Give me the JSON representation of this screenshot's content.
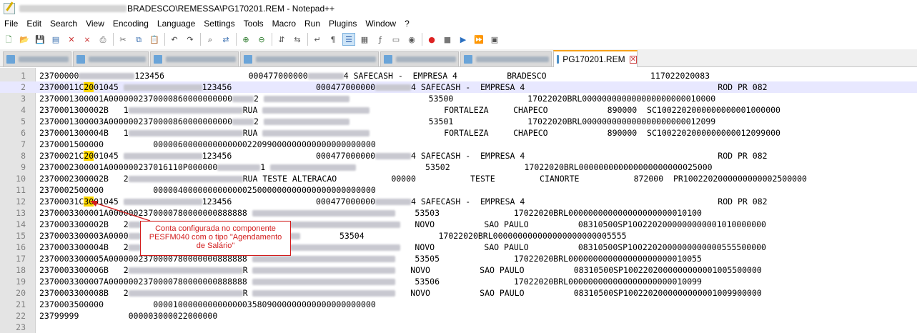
{
  "window": {
    "title": "BRADESCO\\REMESSA\\PG170201.REM - Notepad++"
  },
  "menu": [
    "File",
    "Edit",
    "Search",
    "View",
    "Encoding",
    "Language",
    "Settings",
    "Tools",
    "Macro",
    "Run",
    "Plugins",
    "Window",
    "?"
  ],
  "toolbar": {
    "icons": [
      "new-file-icon",
      "open-file-icon",
      "save-icon",
      "save-all-icon",
      "close-icon",
      "close-all-icon",
      "print-icon",
      "cut-icon",
      "copy-icon",
      "paste-icon",
      "undo-icon",
      "redo-icon",
      "find-icon",
      "replace-icon",
      "zoom-in-icon",
      "zoom-out-icon",
      "sync-vertical-icon",
      "sync-horizontal-icon",
      "word-wrap-icon",
      "show-all-chars-icon",
      "indent-guide-icon",
      "doc-map-icon",
      "function-list-icon",
      "folder-workspace-icon",
      "monitor-icon",
      "record-macro-icon",
      "stop-macro-icon",
      "play-macro-icon",
      "run-macro-multiple-icon",
      "save-macro-icon"
    ]
  },
  "tabs": {
    "active_label": "PG170201.REM"
  },
  "editor": {
    "lines": [
      {
        "n": "1",
        "segs": [
          {
            "t": "23700000"
          },
          {
            "m": 78
          },
          {
            "t": "123456                 000477000000"
          },
          {
            "m": 50
          },
          {
            "t": "4 SAFECASH -  EMPRESA 4          BRADESCO                     117022020083"
          }
        ]
      },
      {
        "n": "2",
        "segs": [
          {
            "t": "23700011C"
          },
          {
            "h": "20"
          },
          {
            "t": "01045 "
          },
          {
            "m": 110
          },
          {
            "t": "123456                 000477000000"
          },
          {
            "m": 50
          },
          {
            "t": "4 SAFECASH -  EMPRESA 4                                       ROD PR 082"
          }
        ],
        "current": true
      },
      {
        "n": "3",
        "segs": [
          {
            "t": "2370001300001A0000002370000860000000000"
          },
          {
            "m": 30
          },
          {
            "t": "2 "
          },
          {
            "m": 120
          },
          {
            "t": "                53500               17022020BRL000000000000000000000010000"
          }
        ]
      },
      {
        "n": "4",
        "segs": [
          {
            "t": "2370001300002B   1"
          },
          {
            "m": 160
          },
          {
            "t": "RUA "
          },
          {
            "m": 150
          },
          {
            "t": "               FORTALEZA     CHAPECO            890000  SC1002202000000000001000000"
          }
        ]
      },
      {
        "n": "5",
        "segs": [
          {
            "t": "2370001300003A0000002370000860000000000"
          },
          {
            "m": 30
          },
          {
            "t": "2 "
          },
          {
            "m": 120
          },
          {
            "t": "                53501               17022020BRL000000000000000000000012099"
          }
        ]
      },
      {
        "n": "6",
        "segs": [
          {
            "t": "2370001300004B   1"
          },
          {
            "m": 160
          },
          {
            "t": "RUA "
          },
          {
            "m": 150
          },
          {
            "t": "               FORTALEZA     CHAPECO            890000  SC1002202000000000012099000"
          }
        ]
      },
      {
        "n": "7",
        "segs": [
          {
            "t": "2370001500000          000006000000000000022099000000000000000000000"
          }
        ]
      },
      {
        "n": "8",
        "segs": [
          {
            "t": "23700021C"
          },
          {
            "h": "20"
          },
          {
            "t": "01045 "
          },
          {
            "m": 110
          },
          {
            "t": "123456                 000477000000"
          },
          {
            "m": 50
          },
          {
            "t": "4 SAFECASH -  EMPRESA 4                                       ROD PR 082"
          }
        ]
      },
      {
        "n": "9",
        "segs": [
          {
            "t": "2370002300001A000000237016110P000000"
          },
          {
            "m": 60
          },
          {
            "t": "1 "
          },
          {
            "m": 120
          },
          {
            "t": "              53502               17022020BRL000000000000000000000025000"
          }
        ]
      },
      {
        "n": "10",
        "segs": [
          {
            "t": "2370002300002B   2"
          },
          {
            "m": 160
          },
          {
            "t": "RUA TESTE ALTERACAO           00000           TESTE         CIANORTE           872000  PR1002202000000000002500000"
          }
        ]
      },
      {
        "n": "11",
        "segs": [
          {
            "t": "2370002500000          000004000000000000025000000000000000000000000"
          }
        ]
      },
      {
        "n": "12",
        "segs": [
          {
            "t": "23700031C"
          },
          {
            "h": "30"
          },
          {
            "t": "01045 "
          },
          {
            "m": 110
          },
          {
            "t": "123456                 000477000000"
          },
          {
            "m": 50
          },
          {
            "t": "4 SAFECASH -  EMPRESA 4                                       ROD PR 082"
          }
        ]
      },
      {
        "n": "13",
        "segs": [
          {
            "t": "2370003300001A0000002370000780000000888888 "
          },
          {
            "m": 200
          },
          {
            "t": "    53503               17022020BRL000000000000000000000010100"
          }
        ]
      },
      {
        "n": "14",
        "segs": [
          {
            "t": "2370003300002B   2"
          },
          {
            "m": 380
          },
          {
            "t": "   NOVO          SAO PAULO          08310500SP1002202000000000001010000000"
          }
        ]
      },
      {
        "n": "15",
        "segs": [
          {
            "t": "2370003300003A0000"
          },
          {
            "m": 240
          },
          {
            "t": "        53504               17022020BRL000000000000000000000005555"
          }
        ]
      },
      {
        "n": "16",
        "segs": [
          {
            "t": "2370003300004B   2"
          },
          {
            "m": 380
          },
          {
            "t": "   NOVO          SAO PAULO          08310500SP1002202000000000000555500000"
          }
        ]
      },
      {
        "n": "17",
        "segs": [
          {
            "t": "2370003300005A0000002370000780000000888888 "
          },
          {
            "m": 200
          },
          {
            "t": "    53505               17022020BRL000000000000000000000010055"
          }
        ]
      },
      {
        "n": "18",
        "segs": [
          {
            "t": "2370003300006B   2"
          },
          {
            "m": 160
          },
          {
            "t": "R "
          },
          {
            "m": 200
          },
          {
            "t": "   NOVO          SAO PAULO          08310500SP1002202000000000001005500000"
          }
        ]
      },
      {
        "n": "19",
        "segs": [
          {
            "t": "2370003300007A0000002370000780000000888888 "
          },
          {
            "m": 200
          },
          {
            "t": "    53506               17022020BRL000000000000000000000010099"
          }
        ]
      },
      {
        "n": "20",
        "segs": [
          {
            "t": "2370003300008B   2"
          },
          {
            "m": 160
          },
          {
            "t": "R "
          },
          {
            "m": 200
          },
          {
            "t": "   NOVO          SAO PAULO          08310500SP1002202000000000001009900000"
          }
        ]
      },
      {
        "n": "21",
        "segs": [
          {
            "t": "2370003500000          000010000000000000035809000000000000000000000"
          }
        ]
      },
      {
        "n": "22",
        "segs": [
          {
            "t": "23799999          000003000022000000"
          }
        ]
      },
      {
        "n": "23",
        "segs": []
      }
    ]
  },
  "callout": {
    "text": "Conta configurada no componente PESFM040 com o tipo \"Agendamento de Salário\""
  },
  "colors": {
    "highlight": "#ffd800",
    "callout_red": "#d21c1c",
    "active_tab_accent": "#f7a21b",
    "current_line": "#e8e8ff"
  }
}
